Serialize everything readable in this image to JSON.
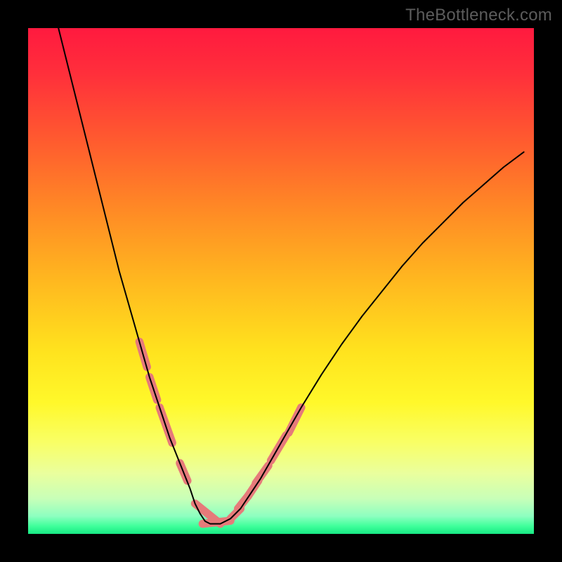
{
  "watermark": "TheBottleneck.com",
  "colors": {
    "frame": "#000000",
    "gradient_stops": [
      {
        "offset": 0.0,
        "color": "#ff1a3f"
      },
      {
        "offset": 0.09,
        "color": "#ff2f3b"
      },
      {
        "offset": 0.22,
        "color": "#ff5a2f"
      },
      {
        "offset": 0.36,
        "color": "#ff8a25"
      },
      {
        "offset": 0.5,
        "color": "#ffb81f"
      },
      {
        "offset": 0.64,
        "color": "#ffe31e"
      },
      {
        "offset": 0.74,
        "color": "#fff82a"
      },
      {
        "offset": 0.82,
        "color": "#f9ff66"
      },
      {
        "offset": 0.88,
        "color": "#eaff9d"
      },
      {
        "offset": 0.93,
        "color": "#c8ffb8"
      },
      {
        "offset": 0.965,
        "color": "#8dffc0"
      },
      {
        "offset": 0.985,
        "color": "#3eff9a"
      },
      {
        "offset": 1.0,
        "color": "#17e884"
      }
    ],
    "curve": "#000000",
    "marker": "#e67a7a"
  },
  "chart_data": {
    "type": "line",
    "title": "",
    "xlabel": "",
    "ylabel": "",
    "xlim": [
      0,
      100
    ],
    "ylim": [
      0,
      100
    ],
    "grid": false,
    "series": [
      {
        "name": "bottleneck-curve",
        "x": [
          6,
          8,
          10,
          12,
          14,
          16,
          18,
          20,
          22,
          24,
          26,
          28,
          30,
          32,
          33,
          34,
          35,
          36,
          38,
          40,
          42,
          44,
          46,
          48,
          50,
          54,
          58,
          62,
          66,
          70,
          74,
          78,
          82,
          86,
          90,
          94,
          98
        ],
        "y": [
          100,
          92,
          84,
          76,
          68,
          60,
          52,
          45,
          38,
          31,
          25,
          19,
          14,
          9,
          6,
          4,
          2.5,
          2,
          2,
          3,
          5,
          8,
          11,
          14.5,
          18,
          25,
          31.5,
          37.5,
          43,
          48,
          53,
          57.5,
          61.5,
          65.5,
          69,
          72.5,
          75.5
        ]
      }
    ],
    "markers": {
      "name": "highlight-segments",
      "segments": [
        {
          "x": [
            22,
            23.5
          ],
          "y": [
            38,
            33
          ]
        },
        {
          "x": [
            24,
            25.5
          ],
          "y": [
            31,
            26.5
          ]
        },
        {
          "x": [
            26,
            28.5
          ],
          "y": [
            25,
            18
          ]
        },
        {
          "x": [
            30,
            31.5
          ],
          "y": [
            14,
            10.5
          ]
        },
        {
          "x": [
            33,
            38
          ],
          "y": [
            6,
            2
          ]
        },
        {
          "x": [
            34.5,
            40
          ],
          "y": [
            2,
            2.6
          ]
        },
        {
          "x": [
            40,
            42
          ],
          "y": [
            3,
            5
          ]
        },
        {
          "x": [
            41.5,
            43.5
          ],
          "y": [
            5,
            7.5
          ]
        },
        {
          "x": [
            43.5,
            45.5
          ],
          "y": [
            7.5,
            10.5
          ]
        },
        {
          "x": [
            45,
            47.5
          ],
          "y": [
            10,
            13.5
          ]
        },
        {
          "x": [
            48,
            51
          ],
          "y": [
            14.5,
            19.5
          ]
        },
        {
          "x": [
            51.5,
            54
          ],
          "y": [
            20,
            25
          ]
        }
      ]
    }
  }
}
